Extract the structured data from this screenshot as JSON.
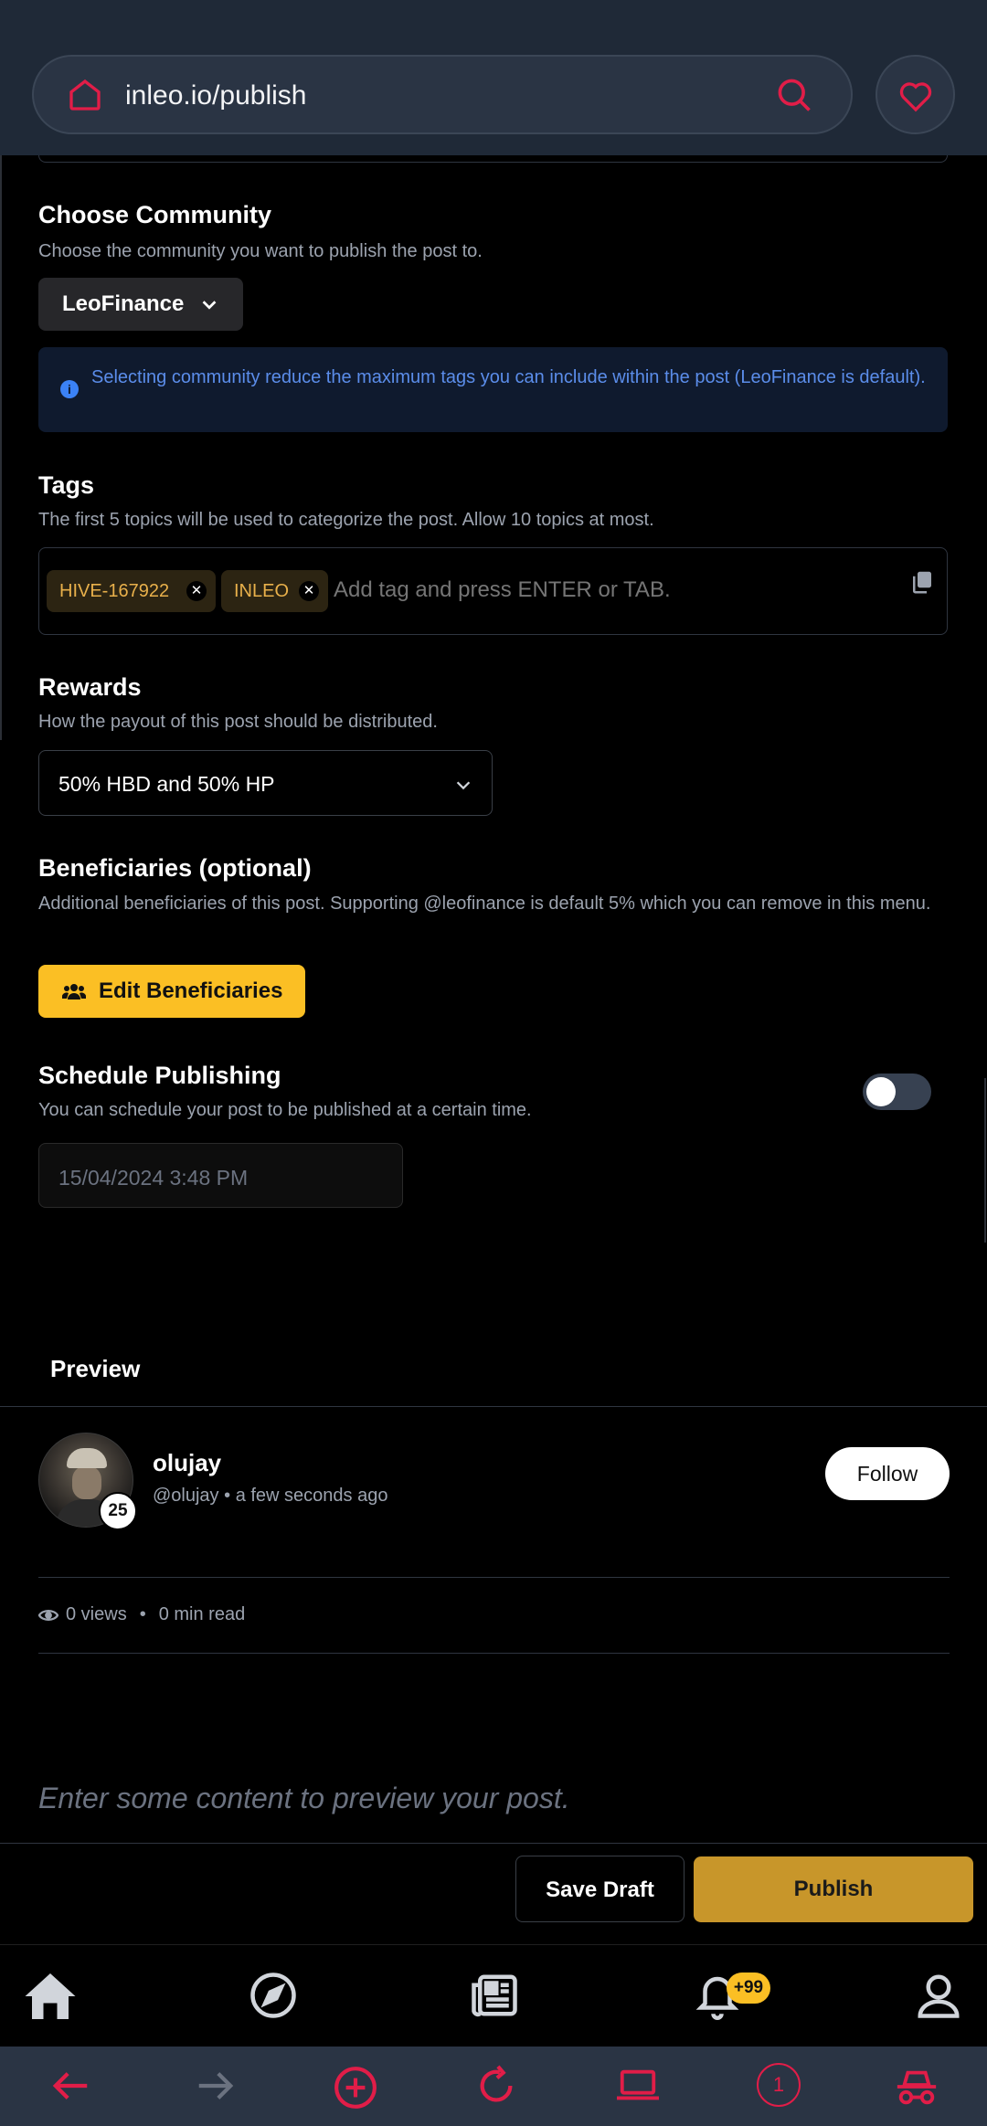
{
  "browser": {
    "url": "inleo.io/publish"
  },
  "community": {
    "title": "Choose Community",
    "subtitle": "Choose the community you want to publish the post to.",
    "selected": "LeoFinance",
    "info": "Selecting community reduce the maximum tags you can include within the post (LeoFinance is default)."
  },
  "tags": {
    "title": "Tags",
    "subtitle": "The first 5 topics will be used to categorize the post. Allow 10 topics at most.",
    "items": [
      "HIVE-167922",
      "INLEO"
    ],
    "placeholder": "Add tag and press ENTER or TAB."
  },
  "rewards": {
    "title": "Rewards",
    "subtitle": "How the payout of this post should be distributed.",
    "selected": "50% HBD and 50% HP"
  },
  "beneficiaries": {
    "title": "Beneficiaries (optional)",
    "subtitle": "Additional beneficiaries of this post. Supporting @leofinance is default 5% which you can remove in this menu.",
    "button": "Edit Beneficiaries"
  },
  "schedule": {
    "title": "Schedule Publishing",
    "subtitle": "You can schedule your post to be published at a certain time.",
    "enabled": false,
    "datetime": "15/04/2024 3:48 PM"
  },
  "preview": {
    "label": "Preview",
    "author": "olujay",
    "handle": "@olujay",
    "time": "a few seconds ago",
    "reputation": "25",
    "follow": "Follow",
    "views": "0 views",
    "read": "0 min read",
    "placeholder": "Enter some content to preview your post."
  },
  "actions": {
    "save_draft": "Save Draft",
    "publish": "Publish"
  },
  "nav": {
    "notifications_badge": "+99"
  },
  "browser_bottom": {
    "tabs_count": "1"
  },
  "colors": {
    "accent": "#fbbf24",
    "publish": "#c8962a",
    "browser_icon": "#e11d48",
    "info_text": "#5b8dea"
  }
}
